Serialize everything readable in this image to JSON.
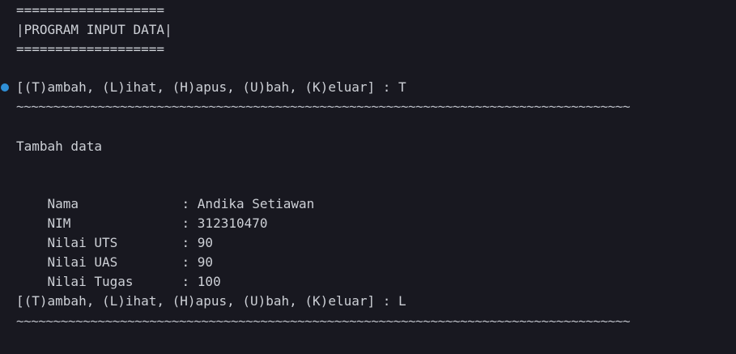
{
  "header": {
    "border_top": "===================",
    "title": "|PROGRAM INPUT DATA|",
    "border_bottom": "==================="
  },
  "menu_prompt_1": {
    "text": "[(T)ambah, (L)ihat, (H)apus, (U)bah, (K)eluar] : T",
    "separator": "~~~~~~~~~~~~~~~~~~~~~~~~~~~~~~~~~~~~~~~~~~~~~~~~~~~~~~~~~~~~~~~~~~~~~~~~~~~~~~~~~~~"
  },
  "section_title": "Tambah data",
  "form": {
    "fields": [
      {
        "label": "Nama",
        "value": ": Andika Setiawan"
      },
      {
        "label": "NIM",
        "value": ": 312310470"
      },
      {
        "label": "Nilai UTS",
        "value": ": 90"
      },
      {
        "label": "Nilai UAS",
        "value": ": 90"
      },
      {
        "label": "Nilai Tugas",
        "value": ": 100"
      }
    ]
  },
  "menu_prompt_2": {
    "text": "[(T)ambah, (L)ihat, (H)apus, (U)bah, (K)eluar] : L",
    "separator": "~~~~~~~~~~~~~~~~~~~~~~~~~~~~~~~~~~~~~~~~~~~~~~~~~~~~~~~~~~~~~~~~~~~~~~~~~~~~~~~~~~~"
  },
  "colors": {
    "background": "#181820",
    "text": "#cdd0d6",
    "marker": "#2f8fd6"
  }
}
